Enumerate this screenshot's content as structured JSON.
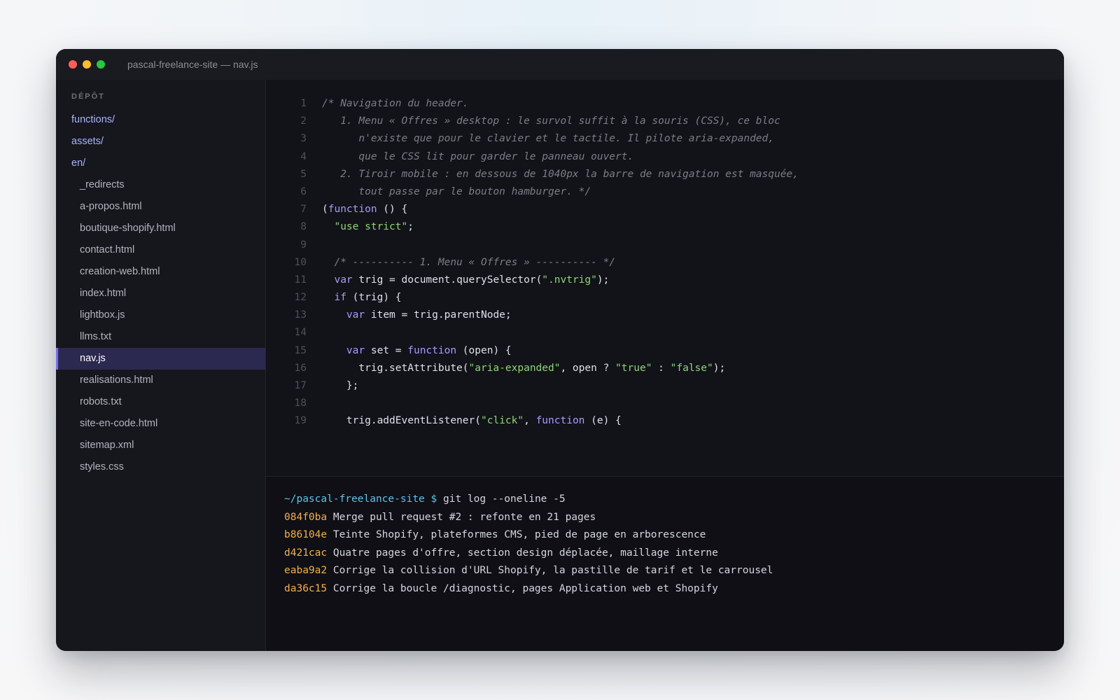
{
  "window": {
    "title": "pascal-freelance-site — nav.js"
  },
  "sidebar": {
    "heading": "DÉPÔT",
    "items": [
      {
        "label": "functions/",
        "type": "dir"
      },
      {
        "label": "assets/",
        "type": "dir"
      },
      {
        "label": "en/",
        "type": "dir"
      },
      {
        "label": "_redirects",
        "type": "file"
      },
      {
        "label": "a-propos.html",
        "type": "file"
      },
      {
        "label": "boutique-shopify.html",
        "type": "file"
      },
      {
        "label": "contact.html",
        "type": "file"
      },
      {
        "label": "creation-web.html",
        "type": "file"
      },
      {
        "label": "index.html",
        "type": "file"
      },
      {
        "label": "lightbox.js",
        "type": "file"
      },
      {
        "label": "llms.txt",
        "type": "file"
      },
      {
        "label": "nav.js",
        "type": "file",
        "active": true
      },
      {
        "label": "realisations.html",
        "type": "file"
      },
      {
        "label": "robots.txt",
        "type": "file"
      },
      {
        "label": "site-en-code.html",
        "type": "file"
      },
      {
        "label": "sitemap.xml",
        "type": "file"
      },
      {
        "label": "styles.css",
        "type": "file"
      }
    ]
  },
  "editor": {
    "lines": [
      {
        "n": "1",
        "tokens": [
          {
            "t": "/* Navigation du header.",
            "c": "cmt"
          }
        ]
      },
      {
        "n": "2",
        "tokens": [
          {
            "t": "   1. Menu « Offres » desktop : le survol suffit à la souris (CSS), ce bloc",
            "c": "cmt"
          }
        ]
      },
      {
        "n": "3",
        "tokens": [
          {
            "t": "      n'existe que pour le clavier et le tactile. Il pilote aria-expanded,",
            "c": "cmt"
          }
        ]
      },
      {
        "n": "4",
        "tokens": [
          {
            "t": "      que le CSS lit pour garder le panneau ouvert.",
            "c": "cmt"
          }
        ]
      },
      {
        "n": "5",
        "tokens": [
          {
            "t": "   2. Tiroir mobile : en dessous de 1040px la barre de navigation est masquée,",
            "c": "cmt"
          }
        ]
      },
      {
        "n": "6",
        "tokens": [
          {
            "t": "      tout passe par le bouton hamburger. */",
            "c": "cmt"
          }
        ]
      },
      {
        "n": "7",
        "tokens": [
          {
            "t": "(",
            "c": ""
          },
          {
            "t": "function",
            "c": "kw"
          },
          {
            "t": " () {",
            "c": ""
          }
        ]
      },
      {
        "n": "8",
        "tokens": [
          {
            "t": "  ",
            "c": ""
          },
          {
            "t": "\"use strict\"",
            "c": "str"
          },
          {
            "t": ";",
            "c": ""
          }
        ]
      },
      {
        "n": "9",
        "tokens": []
      },
      {
        "n": "10",
        "tokens": [
          {
            "t": "  /* ---------- 1. Menu « Offres » ---------- */",
            "c": "cmt"
          }
        ]
      },
      {
        "n": "11",
        "tokens": [
          {
            "t": "  ",
            "c": ""
          },
          {
            "t": "var",
            "c": "kw"
          },
          {
            "t": " trig = document.querySelector(",
            "c": ""
          },
          {
            "t": "\".nvtrig\"",
            "c": "str"
          },
          {
            "t": ");",
            "c": ""
          }
        ]
      },
      {
        "n": "12",
        "tokens": [
          {
            "t": "  ",
            "c": ""
          },
          {
            "t": "if",
            "c": "kw"
          },
          {
            "t": " (trig) {",
            "c": ""
          }
        ]
      },
      {
        "n": "13",
        "tokens": [
          {
            "t": "    ",
            "c": ""
          },
          {
            "t": "var",
            "c": "kw"
          },
          {
            "t": " item = trig.parentNode;",
            "c": ""
          }
        ]
      },
      {
        "n": "14",
        "tokens": []
      },
      {
        "n": "15",
        "tokens": [
          {
            "t": "    ",
            "c": ""
          },
          {
            "t": "var",
            "c": "kw"
          },
          {
            "t": " set = ",
            "c": ""
          },
          {
            "t": "function",
            "c": "kw"
          },
          {
            "t": " (open) {",
            "c": ""
          }
        ]
      },
      {
        "n": "16",
        "tokens": [
          {
            "t": "      trig.setAttribute(",
            "c": ""
          },
          {
            "t": "\"aria-expanded\"",
            "c": "str"
          },
          {
            "t": ", open ? ",
            "c": ""
          },
          {
            "t": "\"true\"",
            "c": "str"
          },
          {
            "t": " : ",
            "c": ""
          },
          {
            "t": "\"false\"",
            "c": "str"
          },
          {
            "t": ");",
            "c": ""
          }
        ]
      },
      {
        "n": "17",
        "tokens": [
          {
            "t": "    };",
            "c": ""
          }
        ]
      },
      {
        "n": "18",
        "tokens": []
      },
      {
        "n": "19",
        "tokens": [
          {
            "t": "    trig.addEventListener(",
            "c": ""
          },
          {
            "t": "\"click\"",
            "c": "str"
          },
          {
            "t": ", ",
            "c": ""
          },
          {
            "t": "function",
            "c": "kw"
          },
          {
            "t": " (e) {",
            "c": ""
          }
        ]
      }
    ]
  },
  "terminal": {
    "prompt_path": "~/pascal-freelance-site",
    "prompt_sign": "$",
    "command": "git log --oneline -5",
    "commits": [
      {
        "hash": "084f0ba",
        "message": "Merge pull request #2 : refonte en 21 pages"
      },
      {
        "hash": "b86104e",
        "message": "Teinte Shopify, plateformes CMS, pied de page en arborescence"
      },
      {
        "hash": "d421cac",
        "message": "Quatre pages d'offre, section design déplacée, maillage interne"
      },
      {
        "hash": "eaba9a2",
        "message": "Corrige la collision d'URL Shopify, la pastille de tarif et le carrousel"
      },
      {
        "hash": "da36c15",
        "message": "Corrige la boucle /diagnostic, pages Application web et Shopify"
      }
    ]
  },
  "colors": {
    "keyword": "#a89cff",
    "string": "#8ed67a",
    "comment": "#7d7d8a",
    "commit_hash": "#f2b14c",
    "prompt": "#5fc4e8",
    "active_item_bg": "#2c2950",
    "active_item_accent": "#7b6cf0"
  }
}
